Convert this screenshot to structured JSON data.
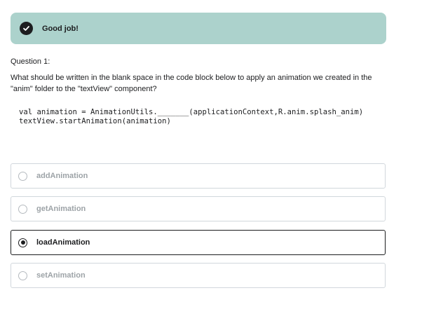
{
  "feedback": {
    "message": "Good job!",
    "icon": "check-circle-icon",
    "background_color": "#acd2cc"
  },
  "question": {
    "label": "Question 1:",
    "text": "What should be written in the blank space in the code block below to apply an animation we created in the \"anim\" folder to the \"textView\" component?",
    "code_lines": [
      "val animation = AnimationUtils._______(applicationContext,R.anim.splash_anim)",
      "textView.startAnimation(animation)"
    ]
  },
  "options": [
    {
      "label": "addAnimation",
      "selected": false
    },
    {
      "label": "getAnimation",
      "selected": false
    },
    {
      "label": "loadAnimation",
      "selected": true
    },
    {
      "label": "setAnimation",
      "selected": false
    }
  ]
}
